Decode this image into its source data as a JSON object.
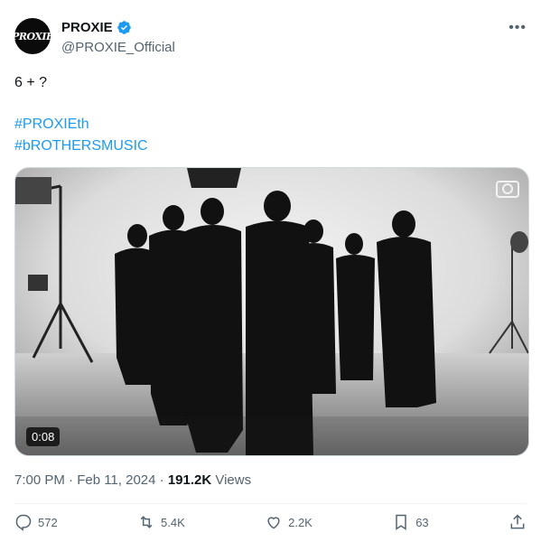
{
  "author": {
    "avatar_text": "PROXIE",
    "name": "PROXIE",
    "handle": "@PROXIE_Official",
    "verified": true
  },
  "more_label": "•••",
  "tweet": {
    "text": "6 + ?",
    "hashtags": [
      "#PROXIEth",
      "#bROTHERSMUSIC"
    ]
  },
  "media": {
    "type": "video",
    "duration": "0:08",
    "description_icon": "camera-icon"
  },
  "meta": {
    "time_date": "7:00 PM · Feb 11, 2024 · ",
    "views_count": "191.2K",
    "views_label": " Views"
  },
  "actions": {
    "replies": "572",
    "reposts": "5.4K",
    "likes": "2.2K",
    "bookmarks": "63"
  },
  "colors": {
    "link": "#1d9bf0",
    "verified": "#1d9bf0",
    "muted": "#536471"
  }
}
